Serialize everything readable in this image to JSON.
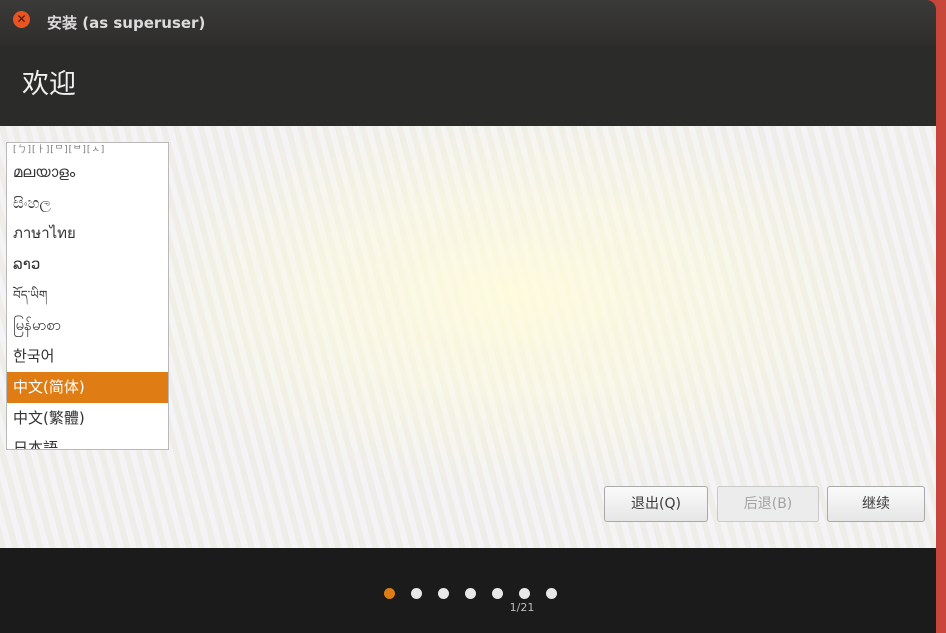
{
  "window": {
    "title": "安装 (as superuser)",
    "close_icon": "close-icon"
  },
  "header": {
    "title": "欢迎"
  },
  "language_list": {
    "items": [
      {
        "label": "[ㄅ][ㅏ][ᄆ][ᄇ][ㅅ]",
        "selected": false
      },
      {
        "label": "മലയാളം",
        "selected": false
      },
      {
        "label": "සිංහල",
        "selected": false
      },
      {
        "label": "ภาษาไทย",
        "selected": false
      },
      {
        "label": "ລາວ",
        "selected": false
      },
      {
        "label": "བོད་ཡིག",
        "selected": false
      },
      {
        "label": "မြန်မာစာ",
        "selected": false
      },
      {
        "label": "한국어",
        "selected": false
      },
      {
        "label": "中文(简体)",
        "selected": true
      },
      {
        "label": "中文(繁體)",
        "selected": false
      },
      {
        "label": "日本語",
        "selected": false
      }
    ]
  },
  "buttons": {
    "quit": "退出(Q)",
    "back": "后退(B)",
    "continue": "继续"
  },
  "progress": {
    "page": "1/21",
    "current_step": 1,
    "visible_dots": 7
  },
  "colors": {
    "accent": "#e07c14",
    "close_button": "#e95420"
  }
}
